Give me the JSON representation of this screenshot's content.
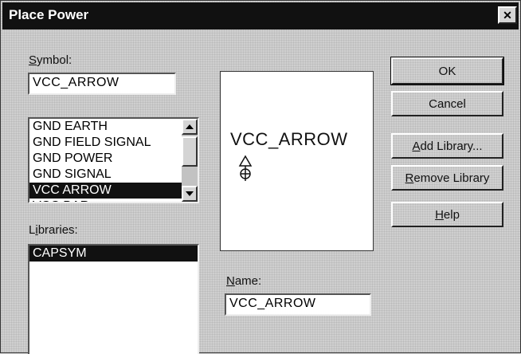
{
  "window": {
    "title": "Place Power",
    "close_glyph": "✕"
  },
  "symbol": {
    "label_key": "S",
    "label_rest": "ymbol:",
    "value": "VCC_ARROW"
  },
  "symbol_list": {
    "items": [
      {
        "label": "GND EARTH",
        "selected": false
      },
      {
        "label": "GND FIELD SIGNAL",
        "selected": false
      },
      {
        "label": "GND POWER",
        "selected": false
      },
      {
        "label": "GND SIGNAL",
        "selected": false
      },
      {
        "label": "VCC ARROW",
        "selected": true
      },
      {
        "label": "VCC BAR",
        "selected": false
      }
    ]
  },
  "libraries": {
    "label_pre": "L",
    "label_key": "i",
    "label_rest": "braries:",
    "items": [
      {
        "label": "CAPSYM",
        "selected": true
      }
    ]
  },
  "preview": {
    "symbol_name": "VCC_ARROW",
    "icon": "vcc-arrow-symbol-icon"
  },
  "name": {
    "label_key": "N",
    "label_rest": "ame:",
    "value": "VCC_ARROW"
  },
  "buttons": {
    "ok": "OK",
    "cancel": "Cancel",
    "add_library_key": "A",
    "add_library_rest": "dd Library...",
    "remove_library_key": "R",
    "remove_library_rest": "emove Library",
    "help_key": "H",
    "help_rest": "elp"
  }
}
